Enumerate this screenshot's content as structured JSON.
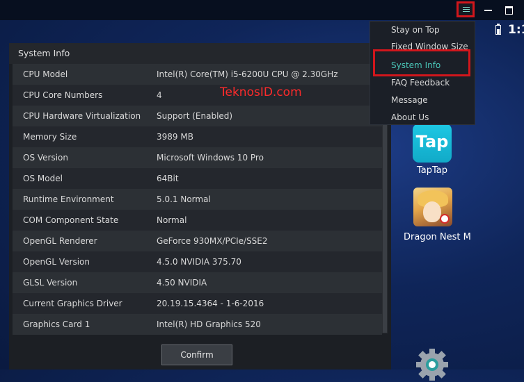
{
  "window": {
    "controls": {
      "menu_icon": "hamburger-menu-icon",
      "minimize_icon": "minimize-icon",
      "maximize_icon": "maximize-icon"
    }
  },
  "status_bar": {
    "time": "1:1",
    "battery_icon": "battery-charging-icon"
  },
  "dropdown_menu": {
    "items": [
      {
        "label": "Stay on Top"
      },
      {
        "label": "Fixed Window Size"
      },
      {
        "label": "System Info"
      },
      {
        "label": "FAQ  Feedback"
      },
      {
        "label": "Message"
      },
      {
        "label": "About Us"
      }
    ],
    "active_item": "System Info",
    "accent_color": "#4ac7b9"
  },
  "system_info": {
    "title": "System Info",
    "rows": [
      {
        "label": "CPU Model",
        "value": "Intel(R) Core(TM) i5-6200U CPU @ 2.30GHz"
      },
      {
        "label": "CPU Core Numbers",
        "value": "4"
      },
      {
        "label": "CPU Hardware Virtualization",
        "value": "Support (Enabled)"
      },
      {
        "label": "Memory Size",
        "value": "3989 MB"
      },
      {
        "label": "OS Version",
        "value": "Microsoft Windows 10 Pro"
      },
      {
        "label": "OS Model",
        "value": "64Bit"
      },
      {
        "label": "Runtime Environment",
        "value": "5.0.1 Normal"
      },
      {
        "label": "COM Component State",
        "value": "Normal"
      },
      {
        "label": "OpenGL Renderer",
        "value": "GeForce 930MX/PCIe/SSE2"
      },
      {
        "label": "OpenGL Version",
        "value": "4.5.0 NVIDIA 375.70"
      },
      {
        "label": "GLSL Version",
        "value": "4.50 NVIDIA"
      },
      {
        "label": "Current Graphics Driver",
        "value": "20.19.15.4364 - 1-6-2016"
      },
      {
        "label": "Graphics Card 1",
        "value": "Intel(R) HD Graphics 520"
      }
    ],
    "confirm_label": "Confirm"
  },
  "watermark": "TeknosID.com",
  "desktop_apps": [
    {
      "name": "TapTap",
      "icon_text": "Tap"
    },
    {
      "name": "Dragon Nest M"
    }
  ],
  "colors": {
    "highlight_border": "#d2161c",
    "watermark": "#ff2b2b"
  }
}
